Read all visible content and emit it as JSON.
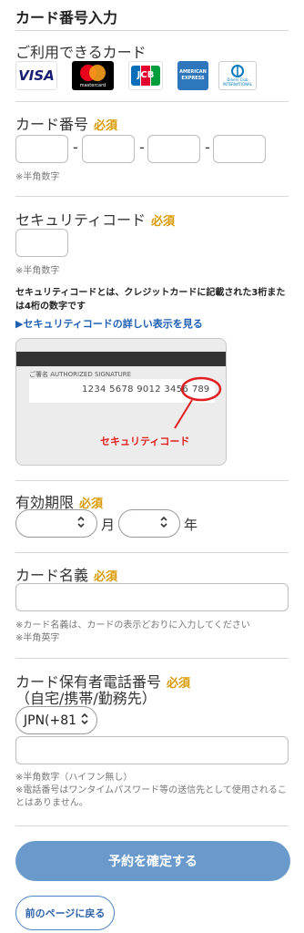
{
  "title": "カード番号入力",
  "cards": {
    "label": "ご利用できるカード",
    "logos": [
      {
        "name": "VISA",
        "color": "#1a1f71"
      },
      {
        "name": "mastercard",
        "color": "#eb001b"
      },
      {
        "name": "JCB",
        "color": "#0b6eb8"
      },
      {
        "name": "AMERICAN EXPRESS",
        "color": "#2e77bc"
      },
      {
        "name": "Diners Club INTERNATIONAL",
        "color": "#0079be"
      }
    ]
  },
  "card_number": {
    "label": "カード番号",
    "required": "必須",
    "separator": "-",
    "note": "※半角数字"
  },
  "security_code": {
    "label": "セキュリティコード",
    "required": "必須",
    "note": "※半角数字",
    "description": "セキュリティコードとは、クレジットカードに記載された3桁または4桁の数字です",
    "link": "▶セキュリティコードの詳しい表示を見る",
    "illustration": {
      "signature_label": "ご署名  AUTHORIZED SIGNATURE",
      "number": "1234 5678 9012 3456",
      "code": "789",
      "caption": "セキュリティコード"
    }
  },
  "expiry": {
    "label": "有効期限",
    "required": "必須",
    "month_suffix": "月",
    "year_suffix": "年"
  },
  "card_name": {
    "label": "カード名義",
    "required": "必須",
    "note1": "※カード名義は、カードの表示どおりに入力してください",
    "note2": "※半角英字"
  },
  "phone": {
    "label_line1": "カード保有者電話番号",
    "required": "必須",
    "label_line2": "（自宅/携帯/勤務先）",
    "country_code": "JPN(+81",
    "note1": "※半角数字（ハイフン無し）",
    "note2": "※電話番号はワンタイムパスワード等の送信先として使用されることはありません。"
  },
  "buttons": {
    "confirm": "予約を確定する",
    "back": "前のページに戻る"
  },
  "colors": {
    "required": "#d99a00",
    "link": "#1e5fb4",
    "primary_button": "#6a9acb",
    "annotation_red": "#e02020"
  }
}
